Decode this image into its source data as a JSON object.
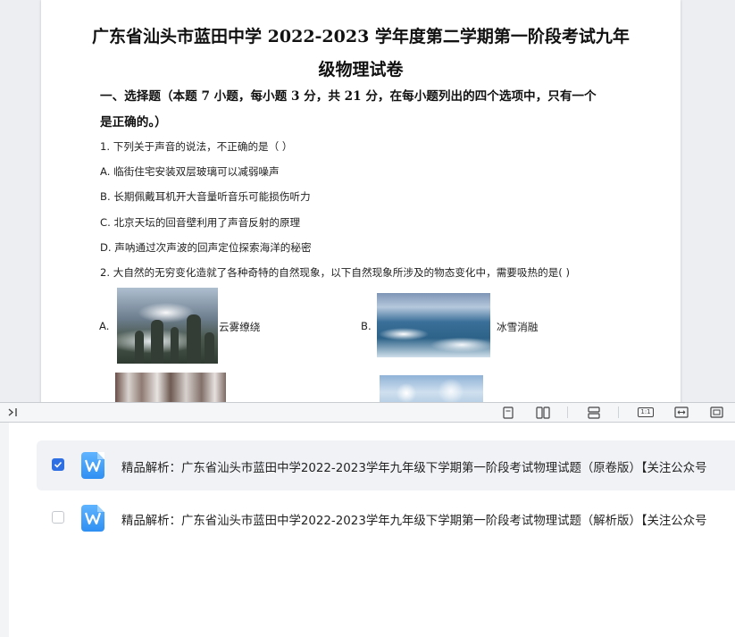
{
  "document": {
    "title_line1": "广东省汕头市蓝田中学 2022-2023 学年度第二学期第一阶段考试九年",
    "title_line2": "级物理试卷",
    "section_line1": "一、选择题（本题 7 小题，每小题 3 分，共 21 分，在每小题列出的四个选项中，只有一个",
    "section_line2": "是正确的。）",
    "q1": {
      "stem": "1. 下列关于声音的说法，不正确的是（      ）",
      "options": [
        "A. 临街住宅安装双层玻璃可以减弱噪声",
        "B. 长期佩戴耳机开大音量听音乐可能损伤听力",
        "C. 北京天坛的回音壁利用了声音反射的原理",
        "D. 声呐通过次声波的回声定位探索海洋的秘密"
      ]
    },
    "q2": {
      "stem": "2. 大自然的无穷变化造就了各种奇特的自然现象，以下自然现象所涉及的物态变化中，需要吸热的是(        )",
      "option_a_letter": "A.",
      "option_a_caption": "云雾缭绕",
      "option_b_letter": "B.",
      "option_b_caption": "冰雪消融"
    }
  },
  "toolbar": {
    "icons": [
      "collapse-panel-icon",
      "single-page-icon",
      "two-page-icon",
      "continuous-scroll-icon",
      "actual-size-icon",
      "fit-width-icon",
      "fit-page-icon"
    ],
    "actual_size_label": "1:1"
  },
  "files": [
    {
      "checked": true,
      "name": "精品解析：广东省汕头市蓝田中学2022-2023学年九年级下学期第一阶段考试物理试题（原卷版）【关注公众号"
    },
    {
      "checked": false,
      "name": "精品解析：广东省汕头市蓝田中学2022-2023学年九年级下学期第一阶段考试物理试题（解析版）【关注公众号"
    }
  ],
  "colors": {
    "accent": "#2f6fe4",
    "word_icon": "#3b9cf7",
    "selected_row": "#f0f2f6"
  }
}
